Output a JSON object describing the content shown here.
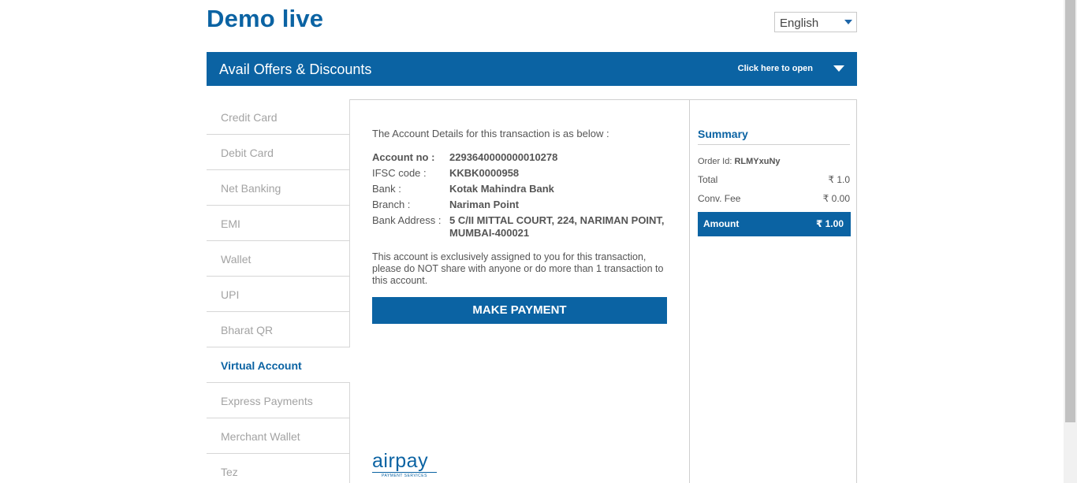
{
  "header": {
    "title": "Demo live",
    "language": "English"
  },
  "offers": {
    "title": "Avail Offers & Discounts",
    "open_label": "Click here to open"
  },
  "sidebar": {
    "items": [
      {
        "label": "Credit Card"
      },
      {
        "label": "Debit Card"
      },
      {
        "label": "Net Banking"
      },
      {
        "label": "EMI"
      },
      {
        "label": "Wallet"
      },
      {
        "label": "UPI"
      },
      {
        "label": "Bharat QR"
      },
      {
        "label": "Virtual Account",
        "active": true
      },
      {
        "label": "Express Payments"
      },
      {
        "label": "Merchant Wallet"
      },
      {
        "label": "Tez"
      }
    ]
  },
  "account": {
    "intro": "The Account Details for this transaction is as below :",
    "account_no_label": "Account no :",
    "account_no": "2293640000000010278",
    "ifsc_label": "IFSC code :",
    "ifsc": "KKBK0000958",
    "bank_label": "Bank :",
    "bank": "Kotak Mahindra Bank",
    "branch_label": "Branch :",
    "branch": "Nariman Point",
    "address_label": "Bank Address :",
    "address": "5 C/II MITTAL COURT, 224, NARIMAN POINT, MUMBAI-400021",
    "note": "This account is exclusively assigned to you for this transaction, please do NOT share with anyone or do more than 1 transaction to this account.",
    "pay_button": "MAKE PAYMENT"
  },
  "logo": {
    "name": "airpay",
    "tagline": "PAYMENT SERVICES"
  },
  "summary": {
    "title": "Summary",
    "order_id_label": "Order Id:",
    "order_id": "RLMYxuNy",
    "total_label": "Total",
    "total": "₹ 1.0",
    "fee_label": "Conv. Fee",
    "fee": "₹ 0.00",
    "amount_label": "Amount",
    "amount": "₹ 1.00"
  },
  "colors": {
    "brand": "#0b63a3"
  }
}
